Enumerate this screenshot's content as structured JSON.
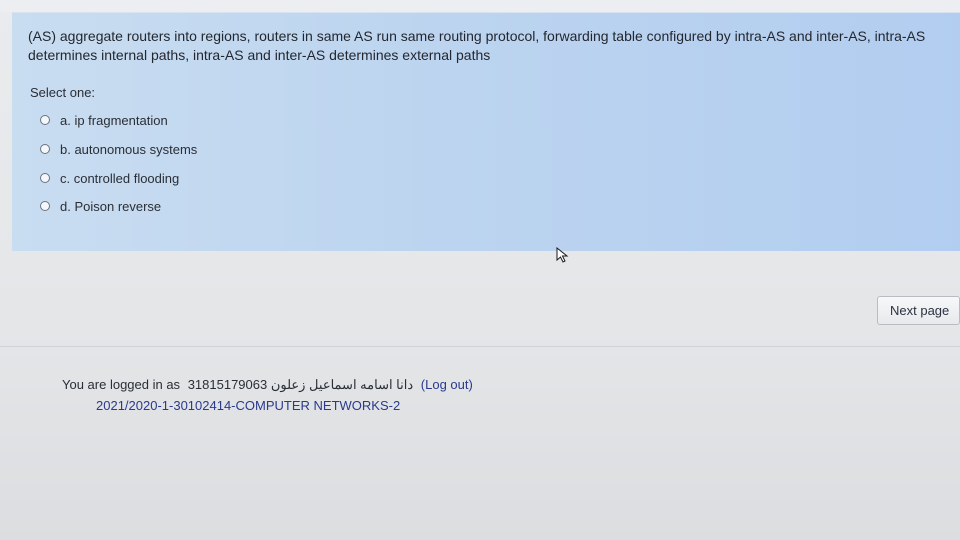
{
  "question": {
    "text": "(AS) aggregate routers into regions, routers in same AS run same routing protocol, forwarding table configured by intra-AS and inter-AS, intra-AS determines internal paths, intra-AS and inter-AS determines external paths",
    "select_label": "Select one:",
    "options": [
      {
        "label": "a. ip fragmentation"
      },
      {
        "label": "b. autonomous systems"
      },
      {
        "label": "c. controlled flooding"
      },
      {
        "label": "d. Poison reverse"
      }
    ]
  },
  "navigation": {
    "next_label": "Next page"
  },
  "footer": {
    "logged_in_prefix": "You are logged in as",
    "user_id_name": "31815179063 دانا اسامه اسماعيل زعلون",
    "logout_label": "(Log out)",
    "course": "2021/2020-1-30102414-COMPUTER NETWORKS-2"
  },
  "icons": {
    "cursor": "mouse-pointer-icon",
    "radio": "radio-button-icon"
  },
  "colors": {
    "card": "#bcd4ef",
    "background": "#e6e8ea",
    "link": "#2a3a8c"
  }
}
